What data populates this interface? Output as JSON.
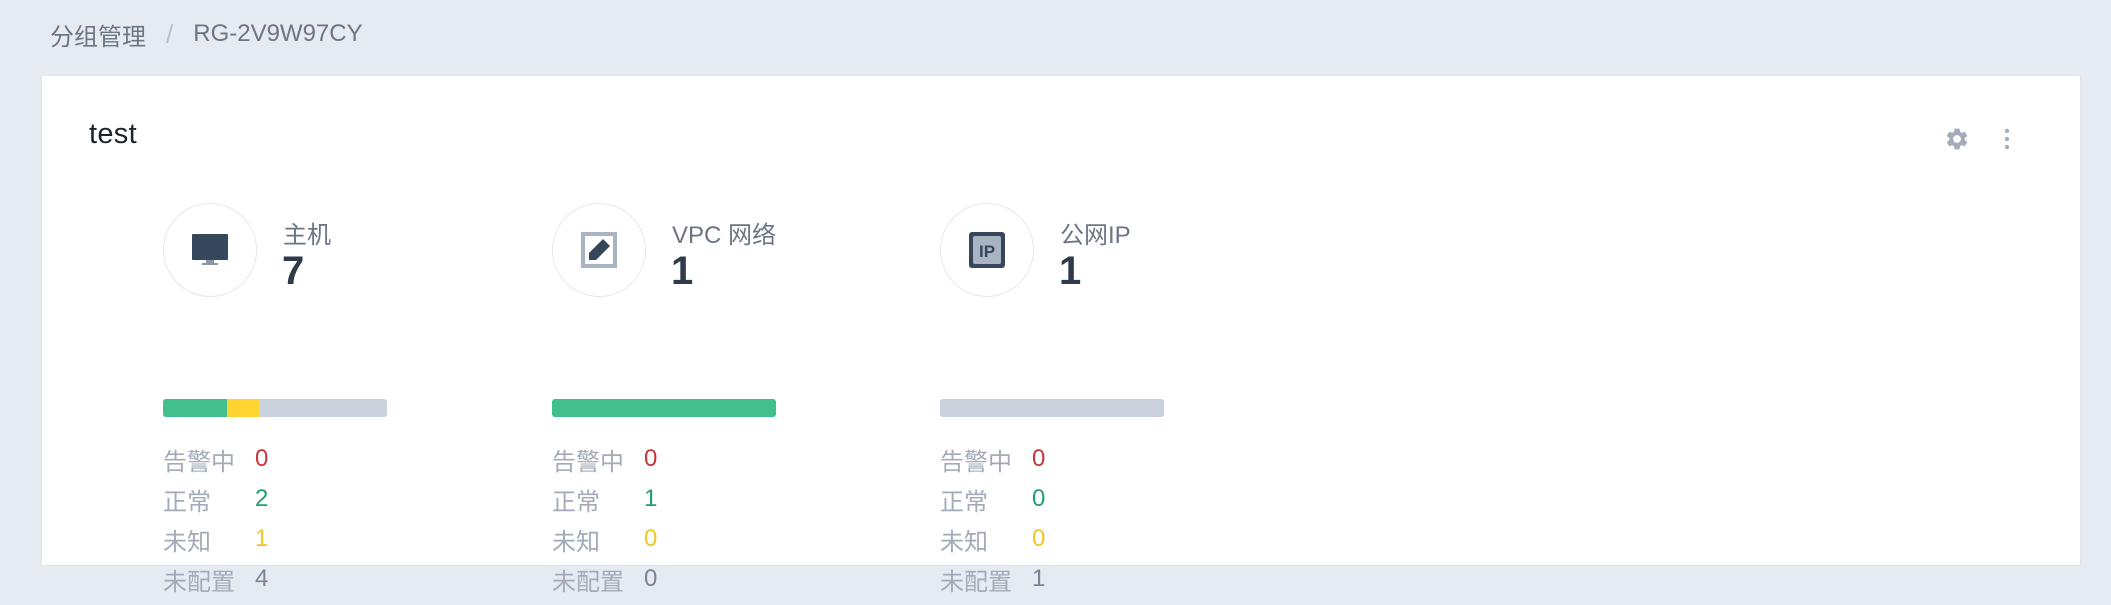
{
  "breadcrumb": {
    "parent": "分组管理",
    "separator": "/",
    "current": "RG-2V9W97CY"
  },
  "card": {
    "title": "test",
    "actions": [
      {
        "icon": "gear-icon"
      },
      {
        "icon": "more-vertical-icon"
      }
    ]
  },
  "colors": {
    "normal": "#41bf8c",
    "unknown": "#fdd430",
    "unconfigured": "#c9d2dd",
    "alarm": "#c8343a",
    "icon_dark": "#36475c"
  },
  "stats": [
    {
      "icon": "monitor-icon",
      "label": "主机",
      "count": "7",
      "bar": {
        "alarm": 0,
        "normal": 2,
        "unknown": 1,
        "unconfigured": 4
      },
      "rows": [
        {
          "key": "告警中",
          "value": "0"
        },
        {
          "key": "正常",
          "value": "2"
        },
        {
          "key": "未知",
          "value": "1"
        },
        {
          "key": "未配置",
          "value": "4"
        }
      ]
    },
    {
      "icon": "vpc-network-icon",
      "label": "VPC 网络",
      "count": "1",
      "bar": {
        "alarm": 0,
        "normal": 1,
        "unknown": 0,
        "unconfigured": 0
      },
      "rows": [
        {
          "key": "告警中",
          "value": "0"
        },
        {
          "key": "正常",
          "value": "1"
        },
        {
          "key": "未知",
          "value": "0"
        },
        {
          "key": "未配置",
          "value": "0"
        }
      ]
    },
    {
      "icon": "public-ip-icon",
      "icon_text": "IP",
      "label": "公网IP",
      "count": "1",
      "bar": {
        "alarm": 0,
        "normal": 0,
        "unknown": 0,
        "unconfigured": 1
      },
      "rows": [
        {
          "key": "告警中",
          "value": "0"
        },
        {
          "key": "正常",
          "value": "0"
        },
        {
          "key": "未知",
          "value": "0"
        },
        {
          "key": "未配置",
          "value": "1"
        }
      ]
    }
  ]
}
